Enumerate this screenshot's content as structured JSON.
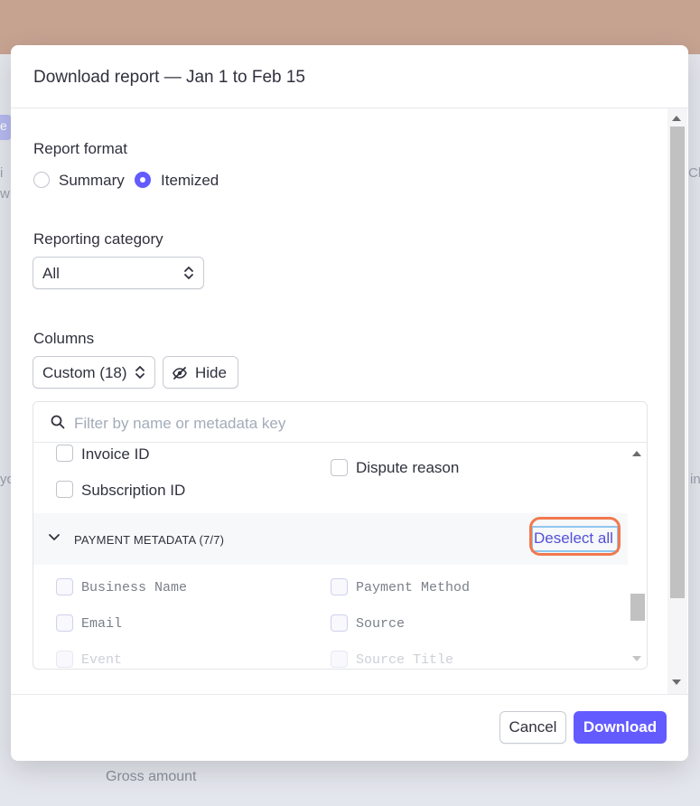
{
  "background": {
    "gross_amount": "Gross amount",
    "fragments": [
      "e",
      "i",
      "w",
      "yo",
      "Cl",
      "in"
    ]
  },
  "modal": {
    "title": "Download report — Jan 1 to Feb 15",
    "report_format": {
      "label": "Report format",
      "options": [
        "Summary",
        "Itemized"
      ],
      "selected": "Itemized"
    },
    "reporting_category": {
      "label": "Reporting category",
      "value": "All"
    },
    "columns": {
      "label": "Columns",
      "value": "Custom (18)",
      "hide_label": "Hide",
      "filter_placeholder": "Filter by name or metadata key",
      "items_left": [
        "Invoice ID",
        "Subscription ID"
      ],
      "items_right": [
        "Dispute reason"
      ],
      "group": {
        "title": "PAYMENT METADATA (7/7)",
        "action": "Deselect all",
        "fields_left": [
          "Business Name",
          "Email",
          "Event"
        ],
        "fields_right": [
          "Payment Method",
          "Source",
          "Source Title"
        ]
      }
    },
    "footer": {
      "cancel": "Cancel",
      "download": "Download"
    }
  },
  "colors": {
    "accent": "#635bff",
    "highlight": "#f0794e"
  }
}
